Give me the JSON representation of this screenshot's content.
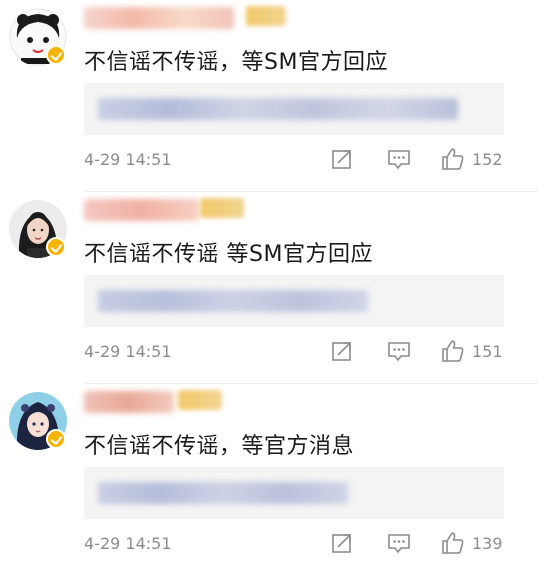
{
  "comments": [
    {
      "text": "不信谣不传谣，等SM官方回应",
      "time": "4-29 14:51",
      "likes": "152"
    },
    {
      "text": "不信谣不传谣 等SM官方回应",
      "time": "4-29 14:51",
      "likes": "151"
    },
    {
      "text": "不信谣不传谣，等官方消息",
      "time": "4-29 14:51",
      "likes": "139"
    }
  ],
  "colors": {
    "verified_badge": "#f6b400",
    "meta_text": "#8c8c8c",
    "quote_bg": "#f4f4f4"
  }
}
